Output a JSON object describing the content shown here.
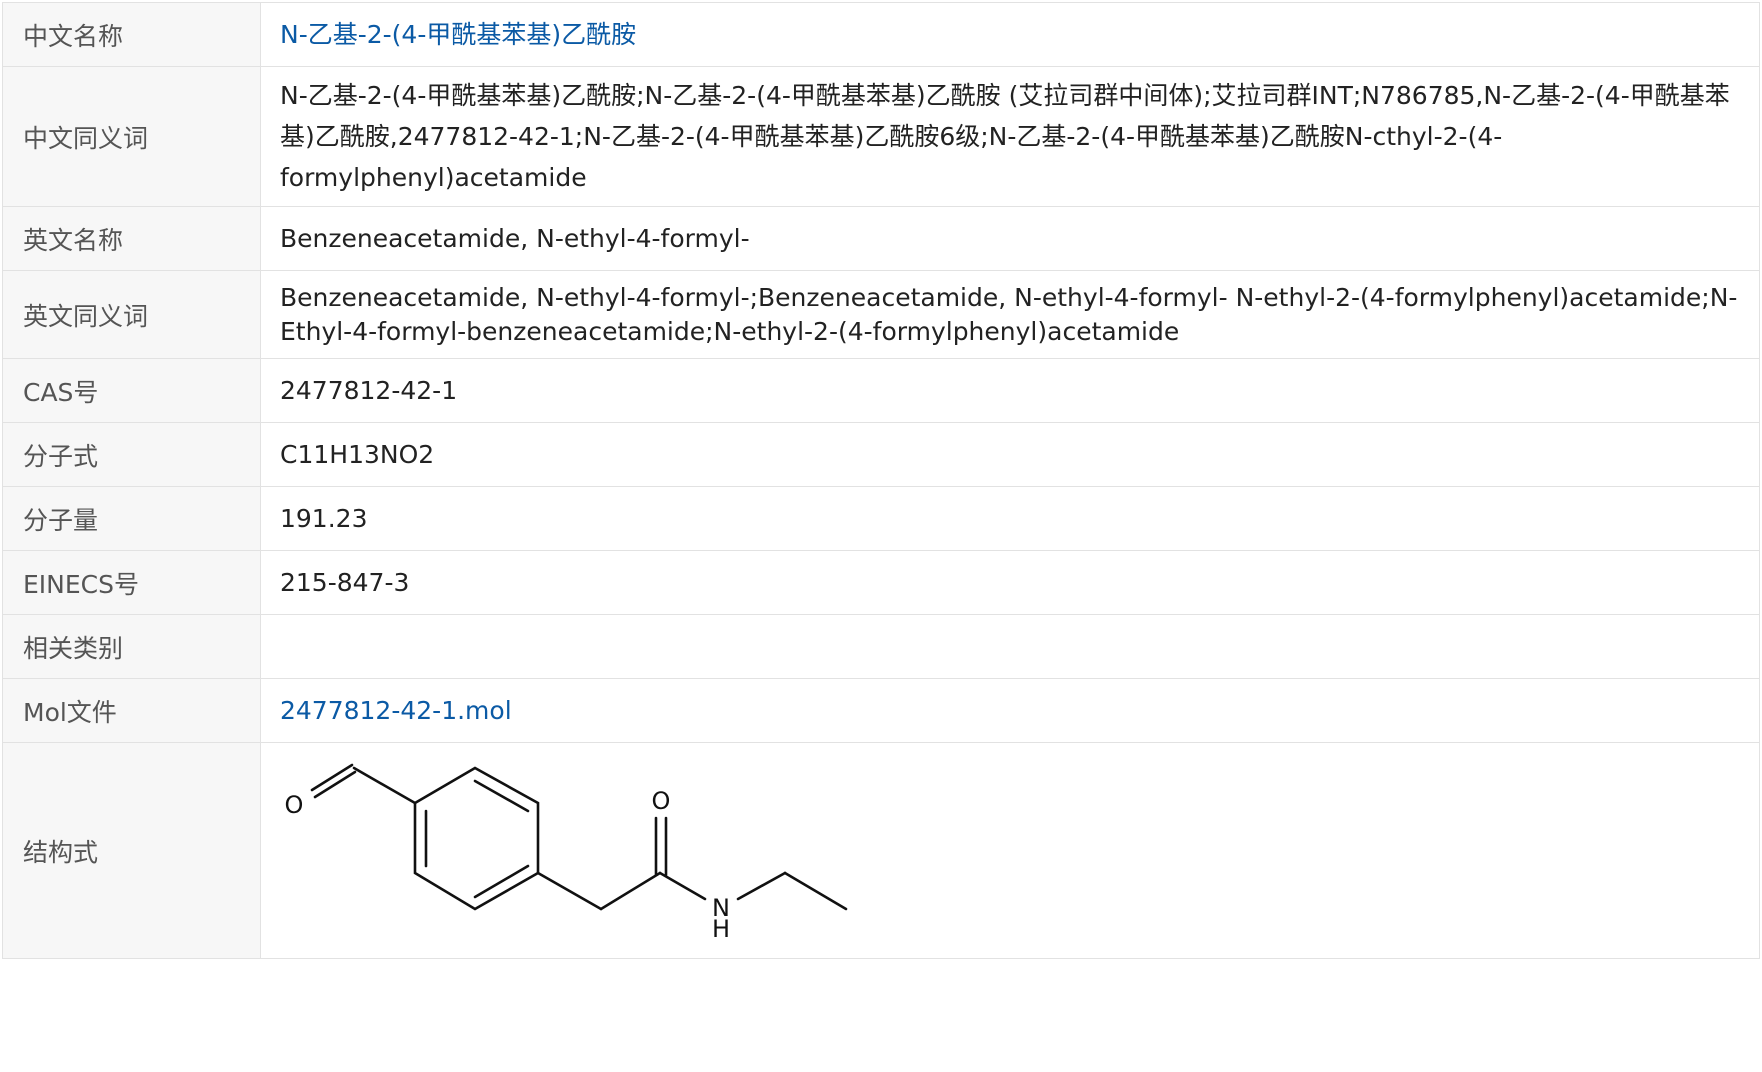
{
  "rows": {
    "cn_name": {
      "label": "中文名称",
      "value": "N-乙基-2-(4-甲酰基苯基)乙酰胺"
    },
    "cn_synonyms": {
      "label": "中文同义词",
      "value": "N-乙基-2-(4-甲酰基苯基)乙酰胺;N-乙基-2-(4-甲酰基苯基)乙酰胺 (艾拉司群中间体);艾拉司群INT;N786785,N-乙基-2-(4-甲酰基苯基)乙酰胺,2477812-42-1;N-乙基-2-(4-甲酰基苯基)乙酰胺6级;N-乙基-2-(4-甲酰基苯基)乙酰胺N-cthyl-2-(4-formylphenyl)acetamide"
    },
    "en_name": {
      "label": "英文名称",
      "value": "Benzeneacetamide, N-ethyl-4-formyl-"
    },
    "en_synonyms": {
      "label": "英文同义词",
      "value": "Benzeneacetamide, N-ethyl-4-formyl-;Benzeneacetamide, N-ethyl-4-formyl- N-ethyl-2-(4-formylphenyl)acetamide;N-Ethyl-4-formyl-benzeneacetamide;N-ethyl-2-(4-formylphenyl)acetamide"
    },
    "cas": {
      "label": "CAS号",
      "value": "2477812-42-1"
    },
    "formula": {
      "label": "分子式",
      "value": "C11H13NO2"
    },
    "mw": {
      "label": "分子量",
      "value": "191.23"
    },
    "einecs": {
      "label": "EINECS号",
      "value": "215-847-3"
    },
    "category": {
      "label": "相关类别",
      "value": ""
    },
    "mol_file": {
      "label": "Mol文件",
      "value": "2477812-42-1.mol"
    },
    "structure": {
      "label": "结构式",
      "atoms": {
        "aldehyde_o": "O",
        "amide_o": "O",
        "amide_n": "N",
        "amide_h": "H"
      }
    }
  },
  "colors": {
    "link": "#0b5aa5",
    "label_bg": "#f7f7f7",
    "border": "#e2e2e2"
  }
}
